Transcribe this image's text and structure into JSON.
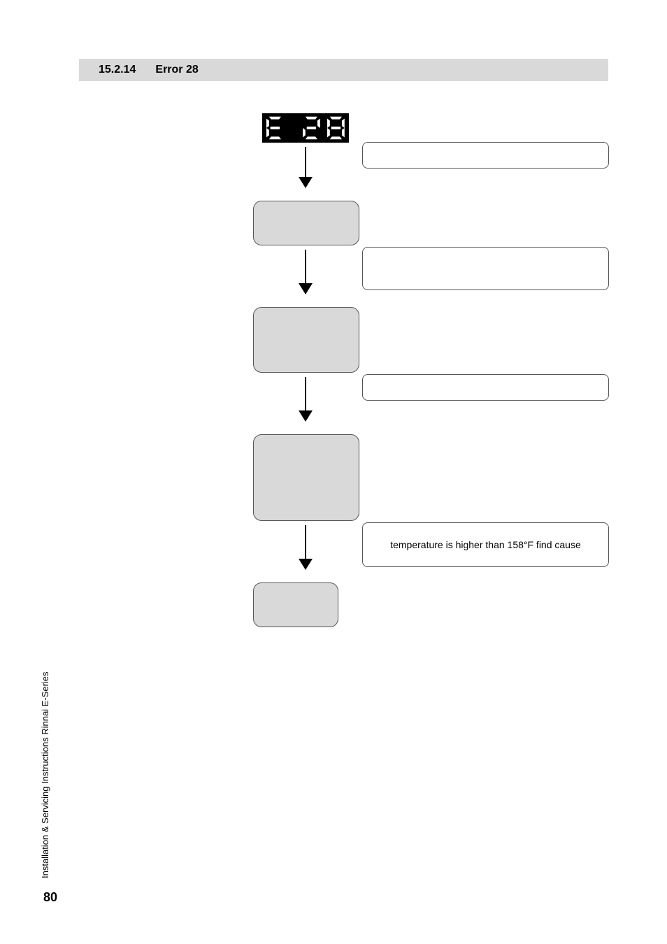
{
  "header": {
    "section": "15.2.14",
    "title": "Error 28"
  },
  "display": {
    "code": "E 28"
  },
  "label_err_desc": "",
  "box_step1": "",
  "label_step1": "",
  "box_step2": "",
  "label_step2": "",
  "box_step3": "",
  "label_step3": "temperature is higher than 158°F find cause",
  "box_step4": "",
  "side_text": "Installation & Servicing Instructions Rinnai E-Series",
  "page_number": "80"
}
